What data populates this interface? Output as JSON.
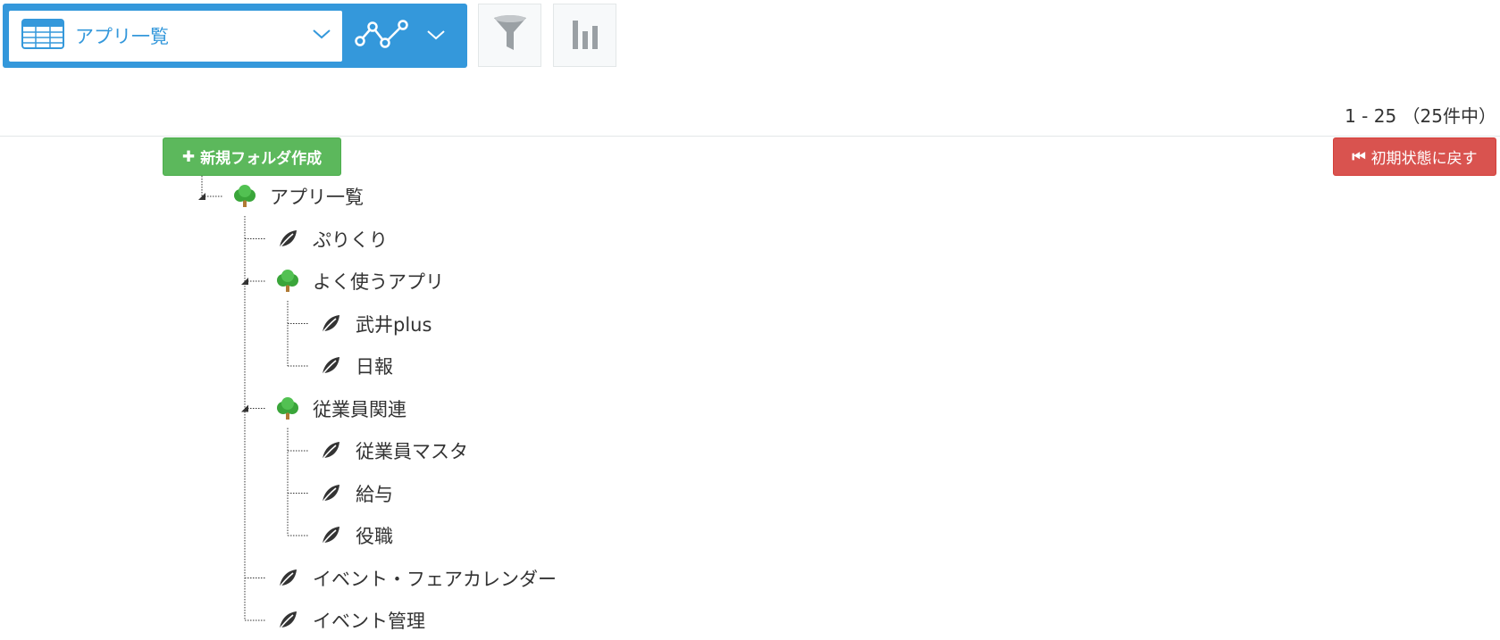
{
  "toolbar": {
    "view_select_label": "アプリ一覧",
    "view_icon": "table-grid-icon",
    "graph_icon": "line-graph-icon",
    "filter_icon": "funnel-icon",
    "chart_icon": "bar-chart-icon"
  },
  "pager": {
    "text": "1 - 25 （25件中）"
  },
  "actions": {
    "new_folder_label": "新規フォルダ作成",
    "new_folder_glyph": "✚",
    "reset_label": "初期状態に戻す",
    "reset_glyph": "⏮"
  },
  "colors": {
    "primary": "#3498db",
    "success": "#5cb85c",
    "danger": "#d9534f",
    "tree_green": "#3aa53a",
    "tree_trunk": "#b07a35"
  },
  "tree": {
    "root": {
      "label": "アプリ一覧",
      "type": "folder",
      "children": [
        {
          "label": "ぷりくり",
          "type": "app"
        },
        {
          "label": "よく使うアプリ",
          "type": "folder",
          "children": [
            {
              "label": "武井plus",
              "type": "app"
            },
            {
              "label": "日報",
              "type": "app"
            }
          ]
        },
        {
          "label": "従業員関連",
          "type": "folder",
          "children": [
            {
              "label": "従業員マスタ",
              "type": "app"
            },
            {
              "label": "給与",
              "type": "app"
            },
            {
              "label": "役職",
              "type": "app"
            }
          ]
        },
        {
          "label": "イベント・フェアカレンダー",
          "type": "app"
        },
        {
          "label": "イベント管理",
          "type": "app"
        }
      ]
    }
  }
}
